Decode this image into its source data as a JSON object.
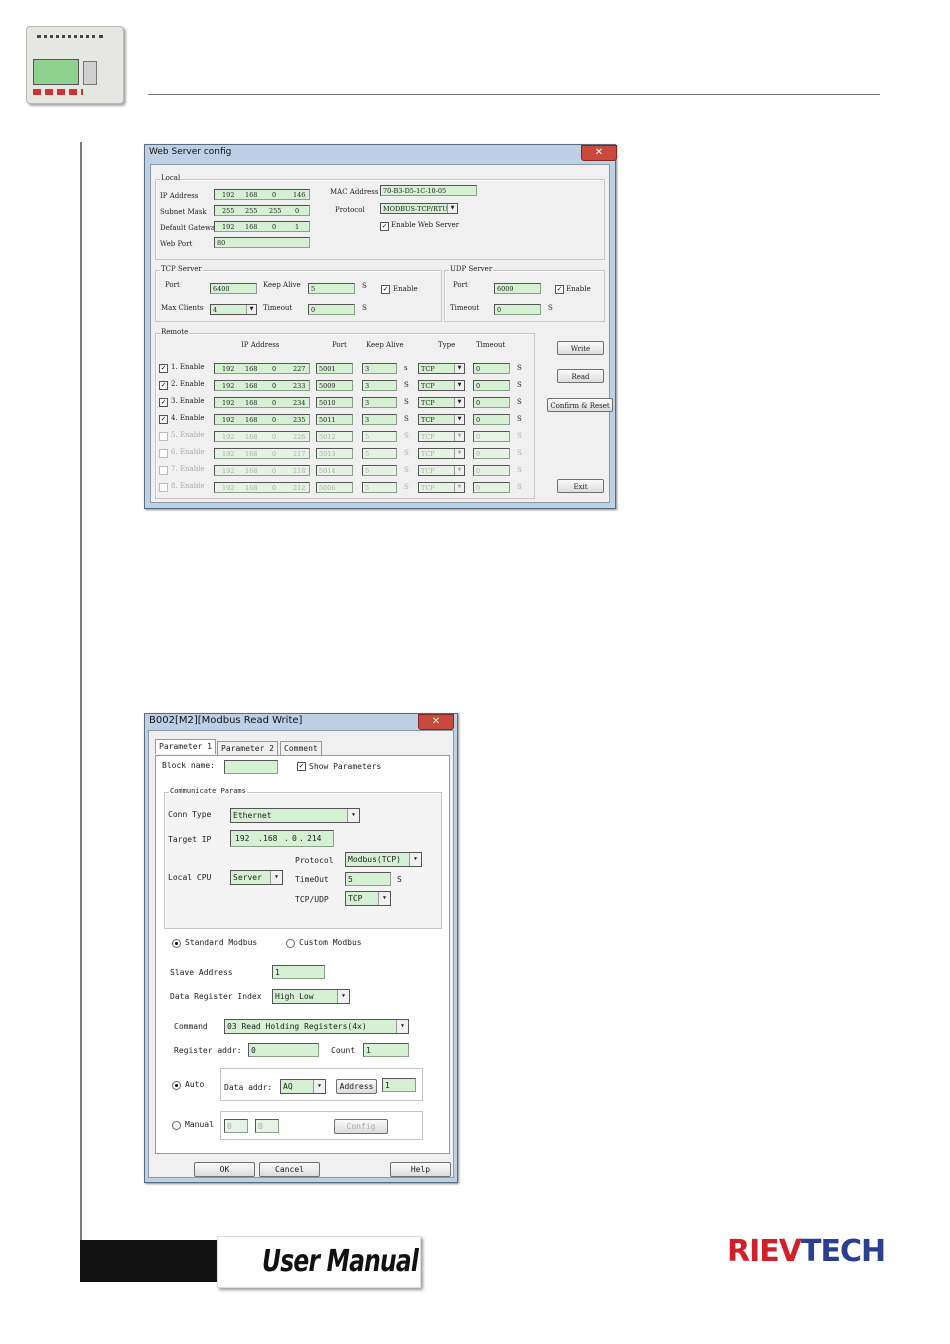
{
  "page": {
    "manual_label": "User Manual",
    "brand_part1": "RIEV",
    "brand_part2": "TECH"
  },
  "web_server_config": {
    "title": "Web Server config",
    "close": "✕",
    "local": {
      "legend": "Local",
      "ip_label": "IP Address",
      "ip": [
        "192",
        "168",
        "0",
        "146"
      ],
      "mask_label": "Subnet Mask",
      "mask": [
        "255",
        "255",
        "255",
        "0"
      ],
      "gateway_label": "Default Gateway",
      "gateway": [
        "192",
        "168",
        "0",
        "1"
      ],
      "webport_label": "Web Port",
      "webport": "80",
      "mac_label": "MAC Address",
      "mac": "70-B3-D5-1C-10-05",
      "protocol_label": "Protocol",
      "protocol": "MODBUS-TCP/RTU",
      "enable_web_label": "Enable Web Server"
    },
    "tcp": {
      "legend": "TCP Server",
      "port_label": "Port",
      "port": "6400",
      "keepalive_label": "Keep Alive",
      "keepalive": "5",
      "s": "S",
      "enable_label": "Enable",
      "maxclients_label": "Max Clients",
      "maxclients": "4",
      "timeout_label": "Timeout",
      "timeout": "0"
    },
    "udp": {
      "legend": "UDP Server",
      "port_label": "Port",
      "port": "6009",
      "enable_label": "Enable",
      "timeout_label": "Timeout",
      "timeout": "0",
      "s": "S"
    },
    "remote": {
      "legend": "Remote",
      "headers": [
        "IP Address",
        "Port",
        "Keep Alive",
        "Type",
        "Timeout"
      ],
      "rows": [
        {
          "label": "1. Enable",
          "ip": [
            "192",
            "168",
            "0",
            "227"
          ],
          "port": "5001",
          "ka": "3",
          "ka_unit": "s",
          "type": "TCP",
          "to": "0",
          "to_unit": "S"
        },
        {
          "label": "2. Enable",
          "ip": [
            "192",
            "168",
            "0",
            "233"
          ],
          "port": "5009",
          "ka": "3",
          "ka_unit": "S",
          "type": "TCP",
          "to": "0",
          "to_unit": "S"
        },
        {
          "label": "3. Enable",
          "ip": [
            "192",
            "168",
            "0",
            "234"
          ],
          "port": "5010",
          "ka": "3",
          "ka_unit": "S",
          "type": "TCP",
          "to": "0",
          "to_unit": "S"
        },
        {
          "label": "4. Enable",
          "ip": [
            "192",
            "168",
            "0",
            "235"
          ],
          "port": "5011",
          "ka": "3",
          "ka_unit": "S",
          "type": "TCP",
          "to": "0",
          "to_unit": "S"
        },
        {
          "label": "5. Enable",
          "ip": [
            "192",
            "168",
            "0",
            "226"
          ],
          "port": "5012",
          "ka": "5",
          "ka_unit": "S",
          "type": "TCP",
          "to": "0",
          "to_unit": "S"
        },
        {
          "label": "6. Enable",
          "ip": [
            "192",
            "168",
            "0",
            "217"
          ],
          "port": "5013",
          "ka": "5",
          "ka_unit": "S",
          "type": "TCP",
          "to": "0",
          "to_unit": "S"
        },
        {
          "label": "7. Enable",
          "ip": [
            "192",
            "168",
            "0",
            "218"
          ],
          "port": "5014",
          "ka": "5",
          "ka_unit": "S",
          "type": "TCP",
          "to": "0",
          "to_unit": "S"
        },
        {
          "label": "8. Enable",
          "ip": [
            "192",
            "168",
            "0",
            "212"
          ],
          "port": "5006",
          "ka": "5",
          "ka_unit": "S",
          "type": "TCP",
          "to": "0",
          "to_unit": "S"
        }
      ]
    },
    "buttons": {
      "write": "Write",
      "read": "Read",
      "confirm": "Confirm & Reset",
      "exit": "Exit"
    }
  },
  "modbus_dialog": {
    "title": "B002[M2][Modbus Read Write]",
    "close": "✕",
    "tabs": [
      "Parameter 1",
      "Parameter 2",
      "Comment"
    ],
    "block_name_label": "Block name:",
    "block_name": "",
    "show_params_label": "Show Parameters",
    "comm_legend": "Communicate Params",
    "conn_type_label": "Conn Type",
    "conn_type": "Ethernet",
    "target_ip_label": "Target IP",
    "target_ip": [
      "192",
      "168",
      "0",
      "214"
    ],
    "protocol_label": "Protocol",
    "protocol": "Modbus(TCP)",
    "local_cpu_label": "Local CPU",
    "local_cpu": "Server",
    "timeout_label": "TimeOut",
    "timeout": "5",
    "timeout_unit": "S",
    "tcpudp_label": "TCP/UDP",
    "tcpudp": "TCP",
    "standard_label": "Standard Modbus",
    "custom_label": "Custom Modbus",
    "slave_label": "Slave Address",
    "slave": "1",
    "index_label": "Data Register Index",
    "index": "High Low",
    "command_label": "Command",
    "command": "03 Read Holding Registers(4x)",
    "reg_addr_label": "Register addr:",
    "reg_addr": "0",
    "count_label": "Count",
    "count": "1",
    "auto_label": "Auto",
    "data_addr_label": "Data addr:",
    "data_addr": "AQ",
    "address_btn": "Address",
    "address_val": "1",
    "manual_label": "Manual",
    "manual_1": "0",
    "manual_2": "0",
    "config_btn": "Config",
    "ok": "OK",
    "cancel": "Cancel",
    "help": "Help"
  }
}
